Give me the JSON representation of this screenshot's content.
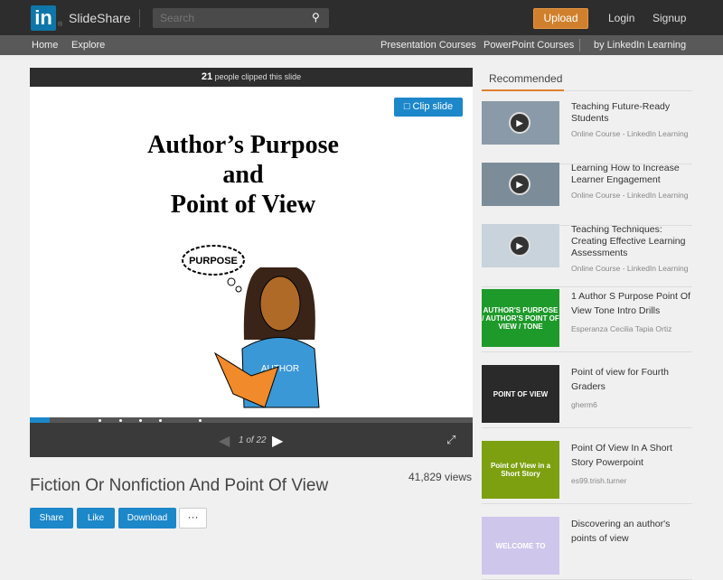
{
  "header": {
    "logo": "in",
    "brand": "SlideShare",
    "search_placeholder": "Search",
    "upload": "Upload",
    "login": "Login",
    "signup": "Signup"
  },
  "subnav": {
    "home": "Home",
    "explore": "Explore",
    "presentation_courses": "Presentation Courses",
    "powerpoint_courses": "PowerPoint Courses",
    "by_linkedin": "by LinkedIn Learning"
  },
  "player": {
    "clip_count": "21",
    "clip_text": "people clipped this slide",
    "clip_button": "Clip slide",
    "slide_title_lines": [
      "Author’s Purpose",
      "and",
      "Point of View"
    ],
    "bubble_text": "PURPOSE",
    "shirt_text": "AUTHOR",
    "page_indicator": "1 of 22",
    "progress_percent": 4.5
  },
  "presentation": {
    "title": "Fiction Or Nonfiction And Point Of View",
    "views": "41,829 views",
    "share": "Share",
    "like": "Like",
    "download": "Download",
    "more": "···"
  },
  "recommended": {
    "heading": "Recommended",
    "items": [
      {
        "title": "Teaching Future-Ready Students",
        "sub": "Online Course - LinkedIn Learning",
        "thumb_text": "",
        "bg": "#8a9aa8",
        "video": true
      },
      {
        "title": "Learning How to Increase Learner Engagement",
        "sub": "Online Course - LinkedIn Learning",
        "thumb_text": "",
        "bg": "#7c8c99",
        "video": true
      },
      {
        "title": "Teaching Techniques: Creating Effective Learning Assessments",
        "sub": "Online Course - LinkedIn Learning",
        "thumb_text": "",
        "bg": "#c9d3db",
        "video": true
      },
      {
        "title": "1 Author S Purpose Point Of View Tone Intro Drills",
        "sub": "Esperanza Cecilia Tapia Ortiz",
        "thumb_text": "AUTHOR'S PURPOSE / AUTHOR'S POINT OF VIEW / TONE",
        "bg": "#1e9a2a",
        "video": false
      },
      {
        "title": "Point of view for Fourth Graders",
        "sub": "gherm6",
        "thumb_text": "POINT OF VIEW",
        "bg": "#2a2a2a",
        "video": false
      },
      {
        "title": "Point Of View In A Short Story Powerpoint",
        "sub": "es99.trish.turner",
        "thumb_text": "Point of View in a Short Story",
        "bg": "#7ca010",
        "video": false
      },
      {
        "title": "Discovering an author's points of view",
        "sub": "",
        "thumb_text": "WELCOME TO",
        "bg": "#cfc6ec",
        "video": false
      }
    ]
  }
}
